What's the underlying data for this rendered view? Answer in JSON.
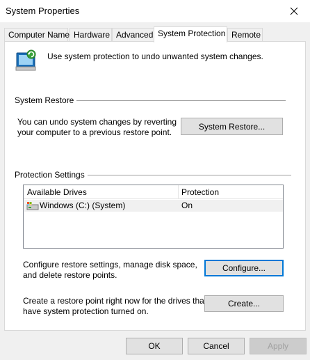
{
  "window": {
    "title": "System Properties"
  },
  "tabs": [
    {
      "label": "Computer Name"
    },
    {
      "label": "Hardware"
    },
    {
      "label": "Advanced"
    },
    {
      "label": "System Protection"
    },
    {
      "label": "Remote"
    }
  ],
  "active_tab": "System Protection",
  "intro_text": "Use system protection to undo unwanted system changes.",
  "system_restore": {
    "group_title": "System Restore",
    "description_line1": "You can undo system changes by reverting",
    "description_line2": "your computer to a previous restore point.",
    "button_label": "System Restore..."
  },
  "protection_settings": {
    "group_title": "Protection Settings",
    "columns": [
      "Available Drives",
      "Protection"
    ],
    "rows": [
      {
        "drive": "Windows (C:) (System)",
        "protection": "On"
      }
    ],
    "configure_text_line1": "Configure restore settings, manage disk space,",
    "configure_text_line2": "and delete restore points.",
    "configure_button": "Configure...",
    "create_text_line1": "Create a restore point right now for the drives that",
    "create_text_line2": "have system protection turned on.",
    "create_button": "Create..."
  },
  "footer": {
    "ok_label": "OK",
    "cancel_label": "Cancel",
    "apply_label": "Apply"
  },
  "colors": {
    "focus_border": "#0078d7",
    "panel_background": "#ffffff",
    "dialog_background": "#f0f0f0"
  }
}
